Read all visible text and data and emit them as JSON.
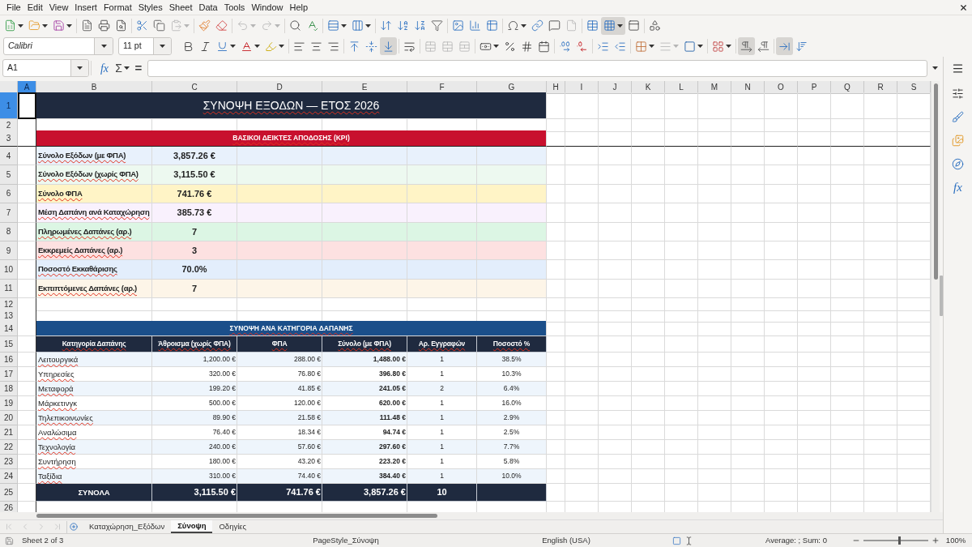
{
  "menu_bar": {
    "items": [
      "File",
      "Edit",
      "View",
      "Insert",
      "Format",
      "Styles",
      "Sheet",
      "Data",
      "Tools",
      "Window",
      "Help"
    ]
  },
  "standard_toolbar": {
    "freeze_rows_and_columns": {
      "pressed": true
    }
  },
  "formatting_toolbar": {
    "font_name": "Calibri",
    "font_size": "11 pt",
    "align_bottom": {
      "pressed": true
    },
    "left_to_right": {
      "pressed": true
    },
    "text_direction_horizontal": {
      "pressed": true
    }
  },
  "formula_bar": {
    "name_box": "A1",
    "function_wizard": "fx",
    "sum": "Σ",
    "equals": "="
  },
  "sidebar": {
    "functions": "fx"
  },
  "sheet": {
    "columns": [
      {
        "label": "A",
        "selected": true
      },
      {
        "label": "B",
        "selected": false
      },
      {
        "label": "C",
        "selected": false
      },
      {
        "label": "D",
        "selected": false
      },
      {
        "label": "E",
        "selected": false
      },
      {
        "label": "F",
        "selected": false
      },
      {
        "label": "G",
        "selected": false
      },
      {
        "label": "H",
        "selected": false
      },
      {
        "label": "I",
        "selected": false
      },
      {
        "label": "J",
        "selected": false
      },
      {
        "label": "K",
        "selected": false
      },
      {
        "label": "L",
        "selected": false
      },
      {
        "label": "M",
        "selected": false
      },
      {
        "label": "N",
        "selected": false
      },
      {
        "label": "O",
        "selected": false
      },
      {
        "label": "P",
        "selected": false
      },
      {
        "label": "Q",
        "selected": false
      },
      {
        "label": "R",
        "selected": false
      },
      {
        "label": "S",
        "selected": false
      }
    ],
    "rows": [
      {
        "label": "1",
        "selected": true
      },
      {
        "label": "2",
        "selected": false
      },
      {
        "label": "3",
        "selected": false
      },
      {
        "label": "4",
        "selected": false
      },
      {
        "label": "5",
        "selected": false
      },
      {
        "label": "6",
        "selected": false
      },
      {
        "label": "7",
        "selected": false
      },
      {
        "label": "8",
        "selected": false
      },
      {
        "label": "9",
        "selected": false
      },
      {
        "label": "10",
        "selected": false
      },
      {
        "label": "11",
        "selected": false
      },
      {
        "label": "12",
        "selected": false
      },
      {
        "label": "13",
        "selected": false
      },
      {
        "label": "14",
        "selected": false
      },
      {
        "label": "15",
        "selected": false
      },
      {
        "label": "16",
        "selected": false
      },
      {
        "label": "17",
        "selected": false
      },
      {
        "label": "18",
        "selected": false
      },
      {
        "label": "19",
        "selected": false
      },
      {
        "label": "20",
        "selected": false
      },
      {
        "label": "21",
        "selected": false
      },
      {
        "label": "22",
        "selected": false
      },
      {
        "label": "23",
        "selected": false
      },
      {
        "label": "24",
        "selected": false
      },
      {
        "label": "25",
        "selected": false
      },
      {
        "label": "26",
        "selected": false
      }
    ],
    "spell_check_marks": true,
    "title": "ΣΥΝΟΨΗ ΕΞΟΔΩΝ — ΕΤΟΣ 2026",
    "kpi_section": {
      "title": "ΒΑΣΙΚΟΙ ΔΕΙΚΤΕΣ ΑΠΟΔΟΣΗΣ (KPI)",
      "items": [
        {
          "label": "Σύνολο Εξόδων (με ΦΠΑ)",
          "value": "3,857.26 €",
          "color": "#e8f1fc"
        },
        {
          "label": "Σύνολο Εξόδων (χωρίς ΦΠΑ)",
          "value": "3,115.50 €",
          "color": "#edf9f0"
        },
        {
          "label": "Σύνολο ΦΠΑ",
          "value": "741.76 €",
          "color": "#fff4c6"
        },
        {
          "label": "Μέση Δαπάνη ανά Καταχώρηση",
          "value": "385.73 €",
          "color": "#f9f1fd"
        },
        {
          "label": "Πληρωμένες Δαπάνες (αρ.)",
          "value": "7",
          "color": "#dcf6e4"
        },
        {
          "label": "Εκκρεμείς Δαπάνες (αρ.)",
          "value": "3",
          "color": "#fde1e1"
        },
        {
          "label": "Ποσοστό Εκκαθάρισης",
          "value": "70.0%",
          "color": "#e3eefc"
        },
        {
          "label": "Εκπιπτόμενες Δαπάνες (αρ.)",
          "value": "7",
          "color": "#fdf5e8"
        }
      ]
    },
    "category_table": {
      "title": "ΣΥΝΟΨΗ ΑΝΑ ΚΑΤΗΓΟΡΙΑ ΔΑΠΑΝΗΣ",
      "columns": [
        "Κατηγορία Δαπάνης",
        "Άθροισμα (χωρίς ΦΠΑ)",
        "ΦΠΑ",
        "Σύνολο (με ΦΠΑ)",
        "Αρ. Εγγραφών",
        "Ποσοστό %"
      ],
      "rows": [
        {
          "category": "Λειτουργικά",
          "net": "1,200.00 €",
          "vat": "288.00 €",
          "gross": "1,488.00 €",
          "entries": "1",
          "share": "38.5%"
        },
        {
          "category": "Υπηρεσίες",
          "net": "320.00 €",
          "vat": "76.80 €",
          "gross": "396.80 €",
          "entries": "1",
          "share": "10.3%"
        },
        {
          "category": "Μεταφορά",
          "net": "199.20 €",
          "vat": "41.85 €",
          "gross": "241.05 €",
          "entries": "2",
          "share": "6.4%"
        },
        {
          "category": "Μάρκετινγκ",
          "net": "500.00 €",
          "vat": "120.00 €",
          "gross": "620.00 €",
          "entries": "1",
          "share": "16.0%"
        },
        {
          "category": "Τηλεπικοινωνίες",
          "net": "89.90 €",
          "vat": "21.58 €",
          "gross": "111.48 €",
          "entries": "1",
          "share": "2.9%"
        },
        {
          "category": "Αναλώσιμα",
          "net": "76.40 €",
          "vat": "18.34 €",
          "gross": "94.74 €",
          "entries": "1",
          "share": "2.5%"
        },
        {
          "category": "Τεχνολογία",
          "net": "240.00 €",
          "vat": "57.60 €",
          "gross": "297.60 €",
          "entries": "1",
          "share": "7.7%"
        },
        {
          "category": "Συντήρηση",
          "net": "180.00 €",
          "vat": "43.20 €",
          "gross": "223.20 €",
          "entries": "1",
          "share": "5.8%"
        },
        {
          "category": "Ταξίδια",
          "net": "310.00 €",
          "vat": "74.40 €",
          "gross": "384.40 €",
          "entries": "1",
          "share": "10.0%"
        }
      ],
      "totals": {
        "label": "ΣΥΝΟΛΑ",
        "net": "3,115.50 €",
        "vat": "741.76 €",
        "gross": "3,857.26 €",
        "entries": "10"
      }
    }
  },
  "sheet_tabs": [
    {
      "label": "Καταχώρηση_Εξόδων",
      "selected": false
    },
    {
      "label": "Σύνοψη",
      "selected": true
    },
    {
      "label": "Οδηγίες",
      "selected": false
    }
  ],
  "status_bar": {
    "sheet_position": "Sheet 2 of 3",
    "page_style": "PageStyle_Σύνοψη",
    "language": "English (USA)",
    "selection_summary": "Average: ; Sum: 0",
    "zoom": {
      "level": 0.55,
      "reading": "100%"
    }
  }
}
